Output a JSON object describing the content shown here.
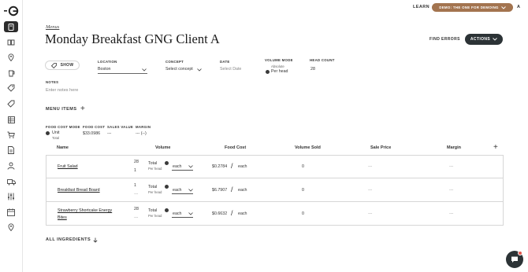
{
  "topbar": {
    "learn_label": "LEARN",
    "demo_label": "DEMO: THE ONE FOR DEMOING",
    "avatar_letter": "A"
  },
  "breadcrumb": "Menus",
  "page_title": "Monday Breakfast GNG Client A",
  "header_actions": {
    "find_errors": "FIND ERRORS",
    "actions": "ACTIONS"
  },
  "filters": {
    "show_label": "SHOW",
    "location": {
      "label": "LOCATION",
      "value": "Boston"
    },
    "concept": {
      "label": "CONCEPT",
      "value": "Select concept"
    },
    "date": {
      "label": "DATE",
      "placeholder": "Select Date"
    },
    "volume_mode": {
      "label": "VOLUME MODE",
      "option_absolute": "Absolute",
      "option_per_head": "Per head",
      "selected": "Per head"
    },
    "head_count": {
      "label": "HEAD COUNT",
      "value": "28"
    }
  },
  "notes": {
    "label": "NOTES",
    "placeholder": "Enter notes here"
  },
  "menu_items_label": "MENU ITEMS",
  "summary": {
    "food_cost_mode_label": "FOOD COST MODE",
    "mode_unit": "Unit",
    "mode_total": "Total",
    "food_cost_label": "FOOD COST",
    "food_cost_value": "$33.0986",
    "sales_value_label": "SALES VALUE",
    "sales_value_value": "---",
    "margin_label": "MARGIN",
    "margin_value": "--- (--)"
  },
  "table": {
    "columns": [
      "Name",
      "Volume",
      "Food Cost",
      "Volume Sold",
      "Sale Price",
      "Margin"
    ],
    "rows": [
      {
        "name": "Fruit Salad",
        "name_line2": "",
        "vol_top": "28",
        "vol_bottom": "1",
        "total_label": "Total",
        "per_head_label": "Per head",
        "unit": "each",
        "food_cost": "$0.2784",
        "food_cost_unit": "each",
        "volume_sold": "0",
        "sale_price": "---",
        "margin": "---"
      },
      {
        "name": "Breakfast Bread Board",
        "name_line2": "",
        "vol_top": "1",
        "vol_bottom": "---",
        "total_label": "Total",
        "per_head_label": "Per head",
        "unit": "each",
        "food_cost": "$6.7907",
        "food_cost_unit": "each",
        "volume_sold": "0",
        "sale_price": "---",
        "margin": "---"
      },
      {
        "name": "Strawberry Shortcake Energy",
        "name_line2": "Bites",
        "vol_top": "28",
        "vol_bottom": "---",
        "total_label": "Total",
        "per_head_label": "Per head",
        "unit": "each",
        "food_cost": "$0.6632",
        "food_cost_unit": "each",
        "volume_sold": "0",
        "sale_price": "---",
        "margin": "---"
      }
    ]
  },
  "all_ingredients_label": "ALL INGREDIENTS",
  "colors": {
    "accent_pill": "#a3744f",
    "dark_button": "#2c3336",
    "notification": "#e2574c"
  },
  "sidebar_icons": [
    "menus-icon",
    "book-icon",
    "location-pin-icon",
    "drink-icon",
    "food-tag-icon",
    "price-tag-icon",
    "grid-icon",
    "cart-icon",
    "document-icon",
    "people-icon",
    "delivery-icon",
    "sliders-icon",
    "calendar-icon",
    "map-pin-icon"
  ]
}
